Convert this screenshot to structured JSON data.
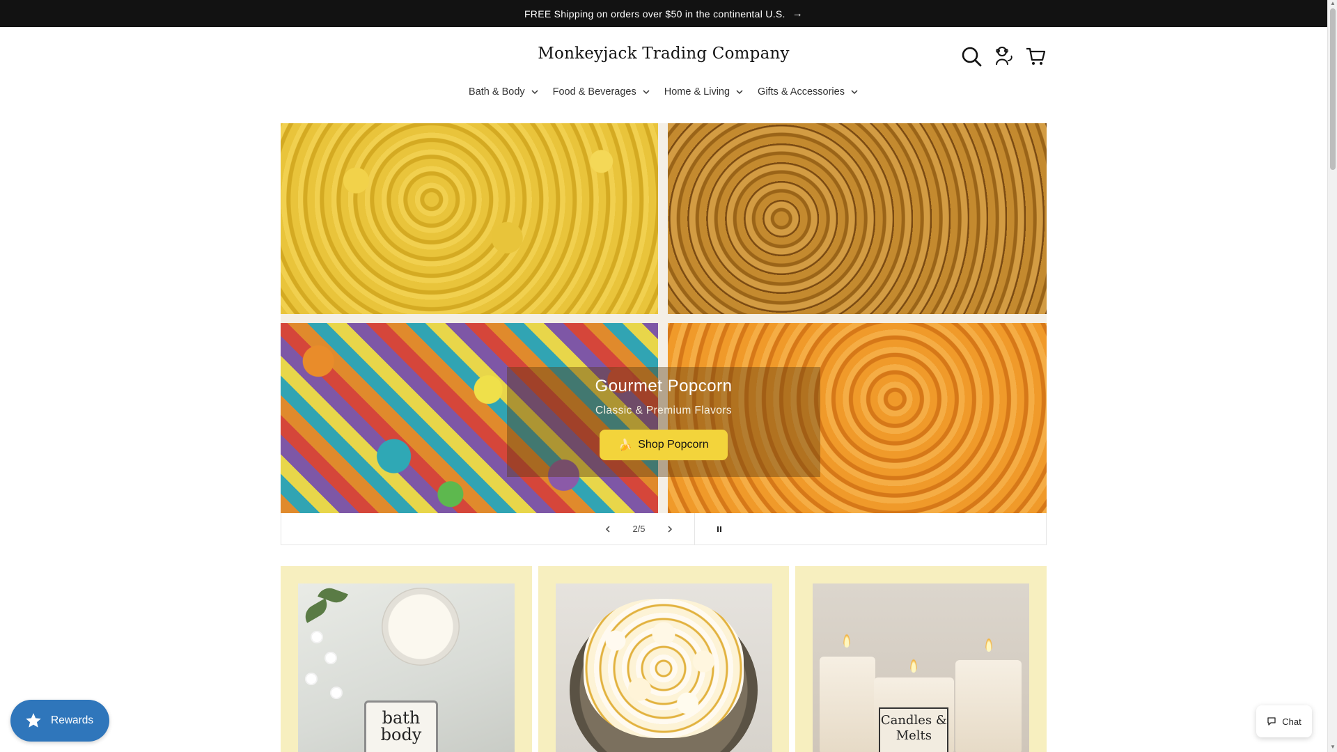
{
  "announcement": {
    "text": "FREE Shipping on orders over $50 in the continental U.S.",
    "arrow": "→"
  },
  "brand": {
    "logo_text": "Monkeyjack Trading Company"
  },
  "header_icons": [
    {
      "name": "search-icon"
    },
    {
      "name": "account-icon"
    },
    {
      "name": "cart-icon"
    }
  ],
  "nav": {
    "items": [
      {
        "label": "Bath & Body"
      },
      {
        "label": "Food & Beverages"
      },
      {
        "label": "Home & Living"
      },
      {
        "label": "Gifts & Accessories"
      }
    ]
  },
  "hero": {
    "title": "Gourmet Popcorn",
    "subtitle": "Classic & Premium Flavors",
    "button_emoji": "🍌",
    "button_label": "Shop Popcorn"
  },
  "slider": {
    "counter": "2/5",
    "current": 2,
    "total": 5
  },
  "cards": [
    {
      "image_text": "bath body"
    },
    {
      "image_text": ""
    },
    {
      "image_text": "Candles & Melts"
    }
  ],
  "rewards": {
    "label": "Rewards"
  },
  "chat": {
    "label": "Chat"
  },
  "colors": {
    "announcement_bg": "#121212",
    "card_bg": "#f7efbf",
    "hero_button": "#f3d43b",
    "rewards_bg": "#2f76bb"
  }
}
